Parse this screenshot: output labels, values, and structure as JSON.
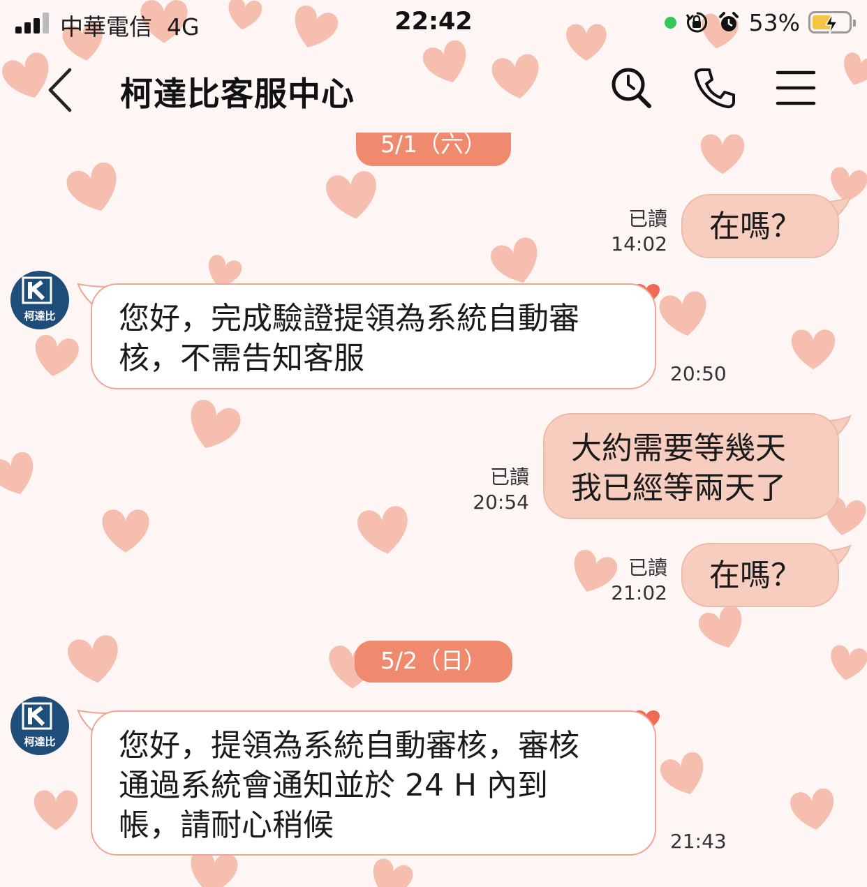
{
  "status_bar": {
    "carrier": "中華電信",
    "network": "4G",
    "time": "22:42",
    "battery": "53%",
    "battery_level": 0.53
  },
  "header": {
    "title": "柯達比客服中心",
    "icons": [
      "back-icon",
      "search-icon",
      "phone-icon",
      "menu-icon"
    ]
  },
  "avatar": {
    "label": "柯達比"
  },
  "messages": [
    {
      "type": "date",
      "label": "5/1（六）"
    },
    {
      "type": "outgoing",
      "text": "在嗎？",
      "read": "已讀",
      "time": "14:02"
    },
    {
      "type": "incoming",
      "text": "您好，完成驗證提領為系統自動審\n核，不需告知客服",
      "time": "20:50"
    },
    {
      "type": "outgoing",
      "text": "大約需要等幾天\n我已經等兩天了",
      "read": "已讀",
      "time": "20:54"
    },
    {
      "type": "outgoing",
      "text": "在嗎？",
      "read": "已讀",
      "time": "21:02"
    },
    {
      "type": "date",
      "label": "5/2（日）"
    },
    {
      "type": "incoming",
      "text": "您好，提領為系統自動審核，審核\n通過系統會通知並於 24 H 內到\n帳，請耐心稍候",
      "time": "21:43"
    }
  ],
  "colors": {
    "date_pill": "#ef8a6e",
    "outgoing_bubble": "#f7cdbf",
    "incoming_border": "#f0a592",
    "background": "#fdf6f4",
    "heart": "#f2ab97"
  }
}
